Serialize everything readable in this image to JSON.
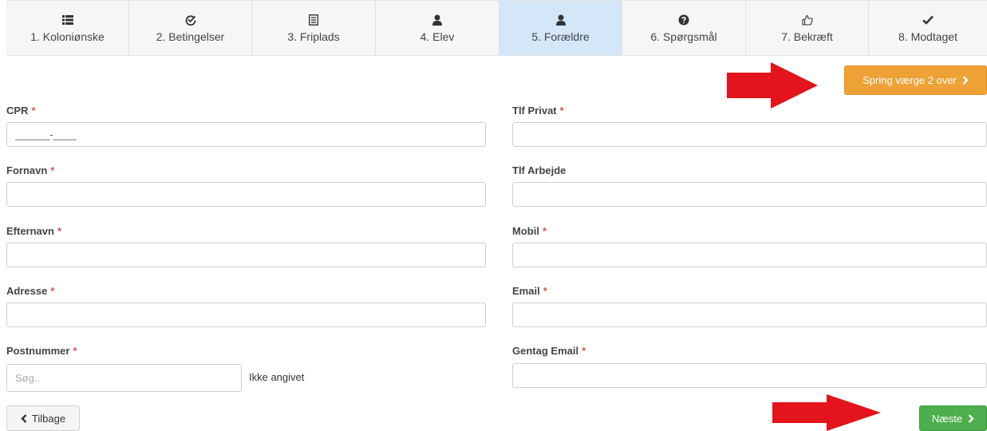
{
  "steps": [
    {
      "label": "1. Koloniønske",
      "icon": "list-icon"
    },
    {
      "label": "2. Betingelser",
      "icon": "check-circle-icon"
    },
    {
      "label": "3. Friplads",
      "icon": "document-icon"
    },
    {
      "label": "4. Elev",
      "icon": "user-icon"
    },
    {
      "label": "5. Forældre",
      "icon": "user-icon",
      "active": true
    },
    {
      "label": "6. Spørgsmål",
      "icon": "question-circle-icon"
    },
    {
      "label": "7. Bekræft",
      "icon": "thumbs-up-icon"
    },
    {
      "label": "8. Modtaget",
      "icon": "checkmark-icon"
    }
  ],
  "skip_button": {
    "label": "Spring værge 2 over",
    "icon": "chevron-right-icon"
  },
  "required_marker": "*",
  "form_left": {
    "cpr": {
      "label": "CPR",
      "value": "______-____"
    },
    "fornavn": {
      "label": "Fornavn",
      "value": ""
    },
    "efternavn": {
      "label": "Efternavn",
      "value": ""
    },
    "adresse": {
      "label": "Adresse",
      "value": ""
    },
    "postnummer": {
      "label": "Postnummer",
      "placeholder": "Søg..",
      "status": "Ikke angivet"
    }
  },
  "form_right": {
    "tlf_privat": {
      "label": "Tlf Privat",
      "value": ""
    },
    "tlf_arbejde": {
      "label": "Tlf Arbejde",
      "value": ""
    },
    "mobil": {
      "label": "Mobil",
      "value": ""
    },
    "email": {
      "label": "Email",
      "value": ""
    },
    "gentag_email": {
      "label": "Gentag Email",
      "value": ""
    }
  },
  "back_button": {
    "label": "Tilbage",
    "icon": "chevron-left-icon"
  },
  "next_button": {
    "label": "Næste",
    "icon": "chevron-right-icon"
  },
  "colors": {
    "active_step": "#d3e7f8",
    "skip": "#eea236",
    "next": "#4cae4c",
    "arrow": "#e3141b",
    "required": "#d9534f"
  }
}
